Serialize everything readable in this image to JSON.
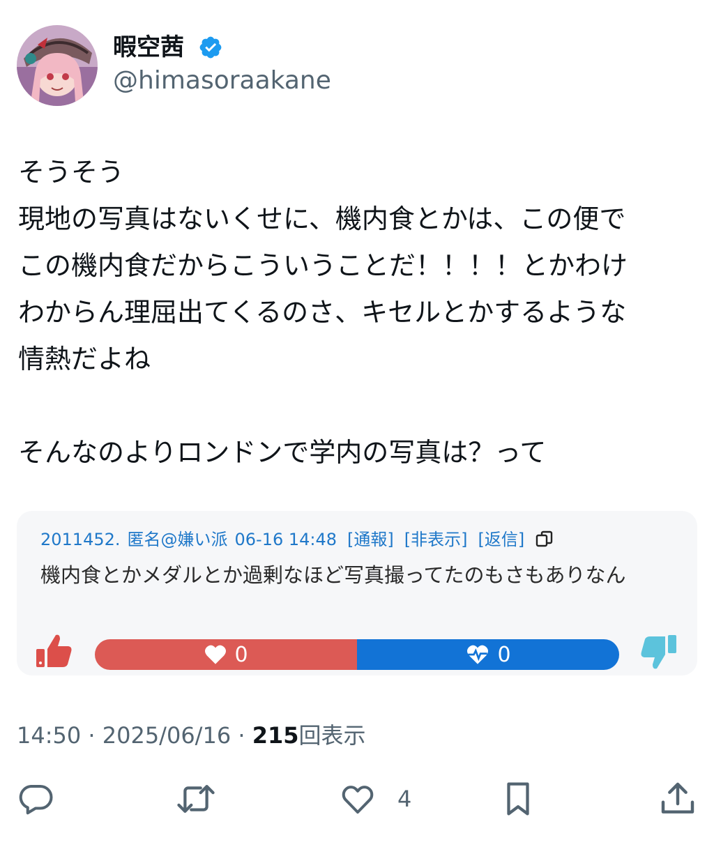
{
  "author": {
    "display_name": "暇空茜",
    "handle": "@himasoraakane",
    "verified": true
  },
  "tweet": {
    "lines": [
      "そうそう",
      "現地の写真はないくせに、機内食とかは、この便で",
      "この機内食だからこういうことだ！！！！とかわけ",
      "わからん理屈出てくるのさ、キセルとかするような",
      "情熱だよね",
      "",
      "そんなのよりロンドンで学内の写真は？って"
    ]
  },
  "quoted_comment": {
    "id": "2011452.",
    "author": "匿名@嫌い派",
    "datetime": "06-16 14:48",
    "report_label": "[通報]",
    "hide_label": "[非表示]",
    "reply_label": "[返信]",
    "text": "機内食とかメダルとか過剰なほど写真撮ってたのもさもありなん",
    "like_count": "0",
    "dislike_count": "0",
    "colors": {
      "like": "#dc5a55",
      "dislike": "#1273d6",
      "meta": "#1f78c9"
    }
  },
  "meta": {
    "time": "14:50",
    "date": "2025/06/16",
    "views": "215",
    "views_label": "回表示",
    "separator": "·"
  },
  "actions": {
    "like_count": "4"
  },
  "icons": [
    "verified-badge-icon",
    "copy-icon",
    "thumbs-up-icon",
    "thumbs-down-icon",
    "heart-icon",
    "heartbeat-icon",
    "reply-icon",
    "retweet-icon",
    "bookmark-icon",
    "share-icon"
  ]
}
